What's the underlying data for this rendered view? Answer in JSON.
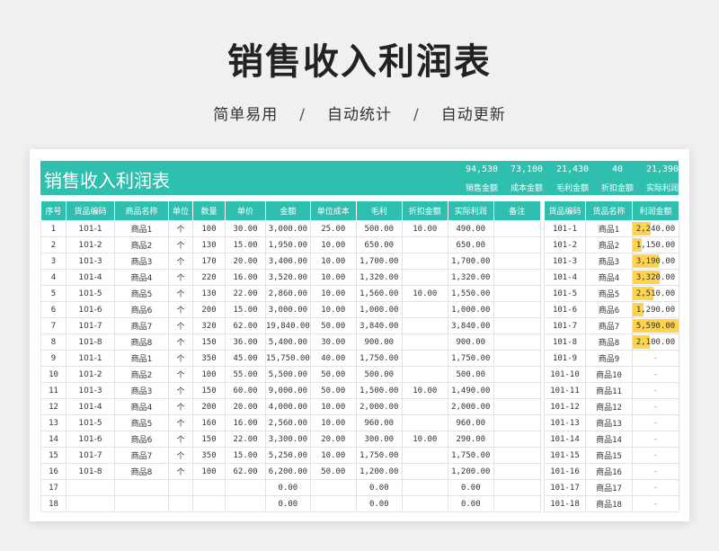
{
  "header": {
    "title": "销售收入利润表",
    "subtitle": [
      "简单易用",
      "自动统计",
      "自动更新"
    ],
    "separator": "/"
  },
  "banner": {
    "title": "销售收入利润表",
    "stats": [
      {
        "value": "94,530",
        "label": "销售金额"
      },
      {
        "value": "73,100",
        "label": "成本金额"
      },
      {
        "value": "21,430",
        "label": "毛利金额"
      },
      {
        "value": "40",
        "label": "折扣金额"
      },
      {
        "value": "21,390",
        "label": "实际利润"
      }
    ]
  },
  "main_table": {
    "columns": [
      "序号",
      "货品编码",
      "商品名称",
      "单位",
      "数量",
      "单价",
      "金额",
      "单位成本",
      "毛利",
      "折扣金额",
      "实际利润",
      "备注"
    ],
    "rows": [
      [
        "1",
        "101-1",
        "商品1",
        "个",
        "100",
        "30.00",
        "3,000.00",
        "25.00",
        "500.00",
        "10.00",
        "490.00",
        ""
      ],
      [
        "2",
        "101-2",
        "商品2",
        "个",
        "130",
        "15.00",
        "1,950.00",
        "10.00",
        "650.00",
        "",
        "650.00",
        ""
      ],
      [
        "3",
        "101-3",
        "商品3",
        "个",
        "170",
        "20.00",
        "3,400.00",
        "10.00",
        "1,700.00",
        "",
        "1,700.00",
        ""
      ],
      [
        "4",
        "101-4",
        "商品4",
        "个",
        "220",
        "16.00",
        "3,520.00",
        "10.00",
        "1,320.00",
        "",
        "1,320.00",
        ""
      ],
      [
        "5",
        "101-5",
        "商品5",
        "个",
        "130",
        "22.00",
        "2,860.00",
        "10.00",
        "1,560.00",
        "10.00",
        "1,550.00",
        ""
      ],
      [
        "6",
        "101-6",
        "商品6",
        "个",
        "200",
        "15.00",
        "3,000.00",
        "10.00",
        "1,000.00",
        "",
        "1,000.00",
        ""
      ],
      [
        "7",
        "101-7",
        "商品7",
        "个",
        "320",
        "62.00",
        "19,840.00",
        "50.00",
        "3,840.00",
        "",
        "3,840.00",
        ""
      ],
      [
        "8",
        "101-8",
        "商品8",
        "个",
        "150",
        "36.00",
        "5,400.00",
        "30.00",
        "900.00",
        "",
        "900.00",
        ""
      ],
      [
        "9",
        "101-1",
        "商品1",
        "个",
        "350",
        "45.00",
        "15,750.00",
        "40.00",
        "1,750.00",
        "",
        "1,750.00",
        ""
      ],
      [
        "10",
        "101-2",
        "商品2",
        "个",
        "100",
        "55.00",
        "5,500.00",
        "50.00",
        "500.00",
        "",
        "500.00",
        ""
      ],
      [
        "11",
        "101-3",
        "商品3",
        "个",
        "150",
        "60.00",
        "9,000.00",
        "50.00",
        "1,500.00",
        "10.00",
        "1,490.00",
        ""
      ],
      [
        "12",
        "101-4",
        "商品4",
        "个",
        "200",
        "20.00",
        "4,000.00",
        "10.00",
        "2,000.00",
        "",
        "2,000.00",
        ""
      ],
      [
        "13",
        "101-5",
        "商品5",
        "个",
        "160",
        "16.00",
        "2,560.00",
        "10.00",
        "960.00",
        "",
        "960.00",
        ""
      ],
      [
        "14",
        "101-6",
        "商品6",
        "个",
        "150",
        "22.00",
        "3,300.00",
        "20.00",
        "300.00",
        "10.00",
        "290.00",
        ""
      ],
      [
        "15",
        "101-7",
        "商品7",
        "个",
        "350",
        "15.00",
        "5,250.00",
        "10.00",
        "1,750.00",
        "",
        "1,750.00",
        ""
      ],
      [
        "16",
        "101-8",
        "商品8",
        "个",
        "100",
        "62.00",
        "6,200.00",
        "50.00",
        "1,200.00",
        "",
        "1,200.00",
        ""
      ],
      [
        "17",
        "",
        "",
        "",
        "",
        "",
        "0.00",
        "",
        "0.00",
        "",
        "0.00",
        ""
      ],
      [
        "18",
        "",
        "",
        "",
        "",
        "",
        "0.00",
        "",
        "0.00",
        "",
        "0.00",
        ""
      ]
    ]
  },
  "side_table": {
    "columns": [
      "货品编码",
      "货品名称",
      "利润金额"
    ],
    "max_value": 5590,
    "rows": [
      {
        "code": "101-1",
        "name": "商品1",
        "profit": "2,240.00",
        "value": 2240
      },
      {
        "code": "101-2",
        "name": "商品2",
        "profit": "1,150.00",
        "value": 1150
      },
      {
        "code": "101-3",
        "name": "商品3",
        "profit": "3,190.00",
        "value": 3190
      },
      {
        "code": "101-4",
        "name": "商品4",
        "profit": "3,320.00",
        "value": 3320
      },
      {
        "code": "101-5",
        "name": "商品5",
        "profit": "2,510.00",
        "value": 2510
      },
      {
        "code": "101-6",
        "name": "商品6",
        "profit": "1,290.00",
        "value": 1290
      },
      {
        "code": "101-7",
        "name": "商品7",
        "profit": "5,590.00",
        "value": 5590
      },
      {
        "code": "101-8",
        "name": "商品8",
        "profit": "2,100.00",
        "value": 2100
      },
      {
        "code": "101-9",
        "name": "商品9",
        "profit": "-",
        "value": 0
      },
      {
        "code": "101-10",
        "name": "商品10",
        "profit": "-",
        "value": 0
      },
      {
        "code": "101-11",
        "name": "商品11",
        "profit": "-",
        "value": 0
      },
      {
        "code": "101-12",
        "name": "商品12",
        "profit": "-",
        "value": 0
      },
      {
        "code": "101-13",
        "name": "商品13",
        "profit": "-",
        "value": 0
      },
      {
        "code": "101-14",
        "name": "商品14",
        "profit": "-",
        "value": 0
      },
      {
        "code": "101-15",
        "name": "商品15",
        "profit": "-",
        "value": 0
      },
      {
        "code": "101-16",
        "name": "商品16",
        "profit": "-",
        "value": 0
      },
      {
        "code": "101-17",
        "name": "商品17",
        "profit": "-",
        "value": 0
      },
      {
        "code": "101-18",
        "name": "商品18",
        "profit": "-",
        "value": 0
      }
    ]
  },
  "colors": {
    "accent": "#2ebfaf",
    "bar": "#ffd34d"
  }
}
